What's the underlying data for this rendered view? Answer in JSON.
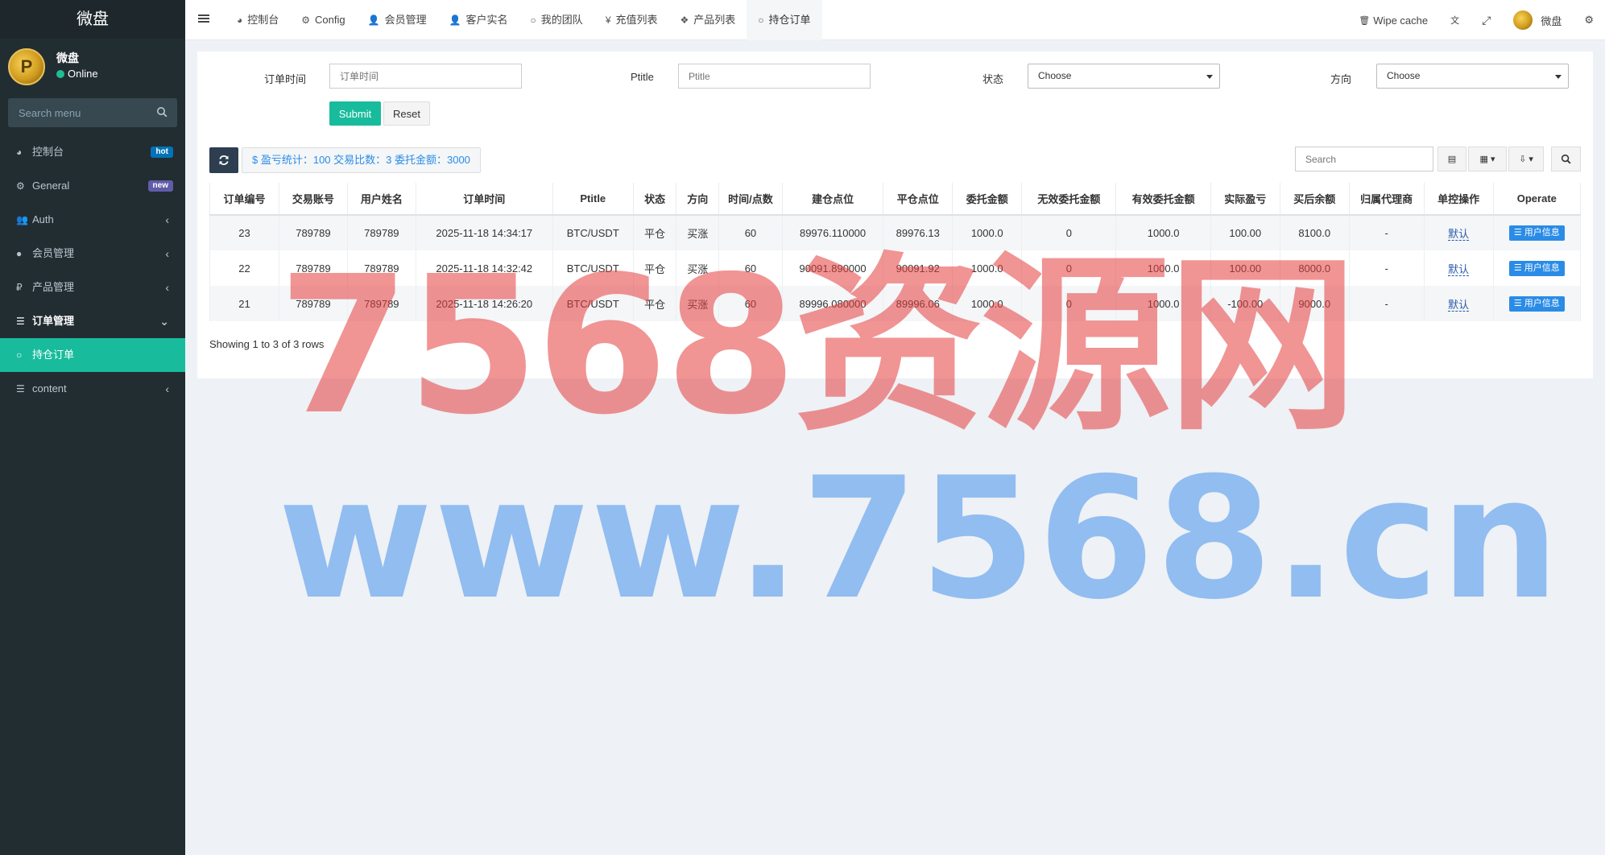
{
  "sidebar": {
    "brand": "微盘",
    "user": {
      "name": "微盘",
      "status": "Online"
    },
    "search_placeholder": "Search menu",
    "items": [
      {
        "label": "控制台",
        "icon": "dashboard-icon",
        "badge": "hot"
      },
      {
        "label": "General",
        "icon": "cogs-icon",
        "badge": "new"
      },
      {
        "label": "Auth",
        "icon": "group-icon"
      },
      {
        "label": "会员管理",
        "icon": "user-circle-icon"
      },
      {
        "label": "产品管理",
        "icon": "ruble-icon"
      },
      {
        "label": "订单管理",
        "icon": "list-icon"
      },
      {
        "label": "持仓订单",
        "icon": "circle-icon"
      },
      {
        "label": "content",
        "icon": "list-icon"
      }
    ]
  },
  "topnav": {
    "tabs": [
      {
        "label": "控制台",
        "icon": "dashboard-icon"
      },
      {
        "label": "Config",
        "icon": "gear-icon"
      },
      {
        "label": "会员管理",
        "icon": "user-icon"
      },
      {
        "label": "客户实名",
        "icon": "user-icon"
      },
      {
        "label": "我的团队",
        "icon": "circle-icon"
      },
      {
        "label": "充值列表",
        "icon": "yen-icon"
      },
      {
        "label": "产品列表",
        "icon": "cubes-icon"
      },
      {
        "label": "持仓订单",
        "icon": "circle-icon"
      }
    ],
    "wipe_cache": "Wipe cache",
    "user_name": "微盘"
  },
  "filters": {
    "order_time_label": "订单时间",
    "order_time_placeholder": "订单时间",
    "ptitle_label": "Ptitle",
    "ptitle_placeholder": "Ptitle",
    "status_label": "状态",
    "status_value": "Choose",
    "direction_label": "方向",
    "direction_value": "Choose",
    "submit": "Submit",
    "reset": "Reset"
  },
  "toolbar": {
    "stats": "$ 盈亏统计：100 交易比数：3 委托金额：3000",
    "search_placeholder": "Search"
  },
  "table": {
    "columns": [
      "订单编号",
      "交易账号",
      "用户姓名",
      "订单时间",
      "Ptitle",
      "状态",
      "方向",
      "时间/点数",
      "建仓点位",
      "平仓点位",
      "委托金额",
      "无效委托金额",
      "有效委托金额",
      "实际盈亏",
      "买后余额",
      "归属代理商",
      "单控操作",
      "Operate"
    ],
    "rows": [
      {
        "id": "23",
        "account": "789789",
        "name": "789789",
        "time": "2025-11-18 14:34:17",
        "ptitle": "BTC/USDT",
        "status": "平仓",
        "direction": "买涨",
        "period": "60",
        "open": "89976.110000",
        "close": "89976.13",
        "amount": "1000.0",
        "invalid": "0",
        "valid": "1000.0",
        "pnl": "100.00",
        "balance": "8100.0",
        "agent": "-",
        "control": "默认",
        "op": "用户信息"
      },
      {
        "id": "22",
        "account": "789789",
        "name": "789789",
        "time": "2025-11-18 14:32:42",
        "ptitle": "BTC/USDT",
        "status": "平仓",
        "direction": "买涨",
        "period": "60",
        "open": "90091.890000",
        "close": "90091.92",
        "amount": "1000.0",
        "invalid": "0",
        "valid": "1000.0",
        "pnl": "100.00",
        "balance": "8000.0",
        "agent": "-",
        "control": "默认",
        "op": "用户信息"
      },
      {
        "id": "21",
        "account": "789789",
        "name": "789789",
        "time": "2025-11-18 14:26:20",
        "ptitle": "BTC/USDT",
        "status": "平仓",
        "direction": "买涨",
        "period": "60",
        "open": "89996.080000",
        "close": "89996.06",
        "amount": "1000.0",
        "invalid": "0",
        "valid": "1000.0",
        "pnl": "-100.00",
        "balance": "9000.0",
        "agent": "-",
        "control": "默认",
        "op": "用户信息"
      }
    ],
    "footer": "Showing 1 to 3 of 3 rows"
  },
  "watermark": {
    "line1": "7568资源网",
    "line2": "www.7568.cn"
  }
}
